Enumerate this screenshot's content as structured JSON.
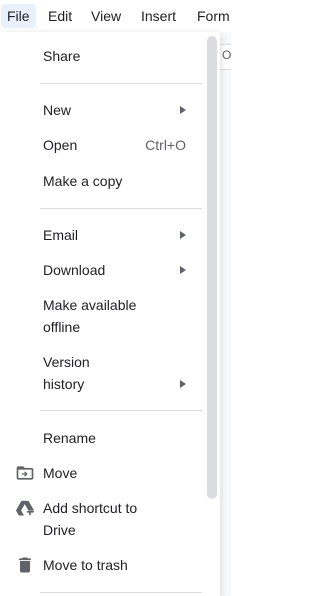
{
  "menubar": {
    "items": [
      {
        "label": "File"
      },
      {
        "label": "Edit"
      },
      {
        "label": "View"
      },
      {
        "label": "Insert"
      },
      {
        "label": "Form"
      }
    ]
  },
  "document": {
    "ruler_fragment": "Or"
  },
  "file_menu": {
    "share": {
      "label": "Share"
    },
    "new": {
      "label": "New",
      "submenu": true
    },
    "open": {
      "label": "Open",
      "shortcut": "Ctrl+O"
    },
    "make_copy": {
      "label": "Make a copy"
    },
    "email": {
      "label": "Email",
      "submenu": true
    },
    "download": {
      "label": "Download",
      "submenu": true
    },
    "make_offline": {
      "label_line1": "Make available",
      "label_line2": "offline"
    },
    "version_history": {
      "label_line1": "Version",
      "label_line2": "history",
      "submenu": true
    },
    "rename": {
      "label": "Rename"
    },
    "move": {
      "label": "Move",
      "icon": "folder-move-icon"
    },
    "add_shortcut": {
      "label_line1": "Add shortcut to",
      "label_line2": "Drive",
      "icon": "drive-shortcut-icon"
    },
    "trash": {
      "label": "Move to trash",
      "icon": "trash-icon"
    }
  },
  "colors": {
    "active_menubar_bg": "#e8f0fe",
    "text": "#202124",
    "secondary_text": "#5f6368",
    "separator": "#dadce0",
    "scrollbar": "#dadce0"
  }
}
